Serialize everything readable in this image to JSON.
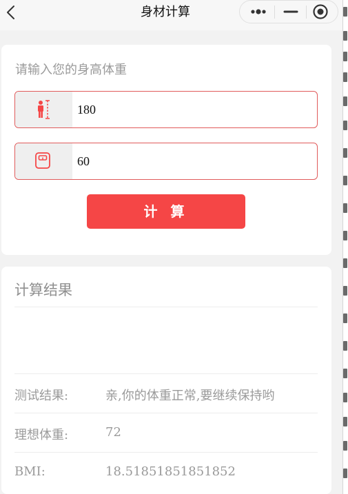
{
  "nav": {
    "title": "身材计算",
    "back_icon": "chevron-left-icon",
    "more_icon": "more-dots-icon",
    "minimize_icon": "minimize-icon",
    "close_icon": "target-close-icon"
  },
  "input_card": {
    "heading": "请输入您的身高体重",
    "height_field": {
      "icon": "height-person-icon",
      "value": "180",
      "color": "#f54646"
    },
    "weight_field": {
      "icon": "scale-icon",
      "value": "60",
      "color": "#f54646"
    },
    "calculate_label": "计 算",
    "accent_color": "#f54646"
  },
  "result_card": {
    "heading": "计算结果",
    "rows": [
      {
        "label": "测试结果:",
        "value": "亲,你的体重正常,要继续保持哟"
      },
      {
        "label": "理想体重:",
        "value": "72"
      },
      {
        "label": "BMI:",
        "value": "18.51851851851852"
      }
    ]
  }
}
